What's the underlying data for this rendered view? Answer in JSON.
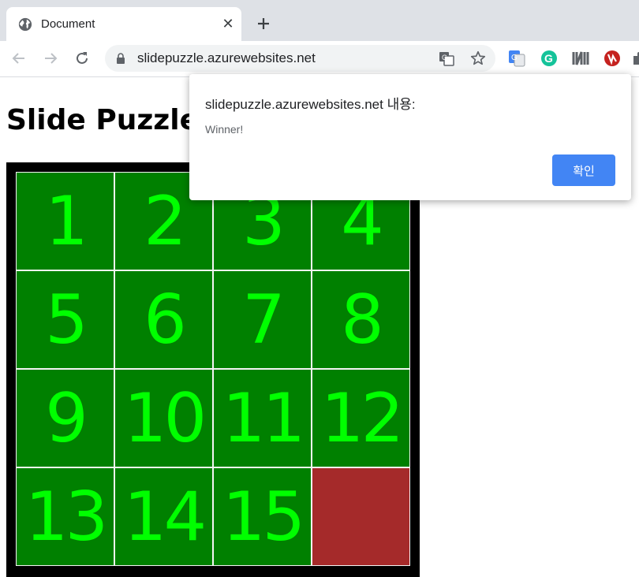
{
  "browser": {
    "tab_title": "Document",
    "url": "slidepuzzle.azurewebsites.net"
  },
  "page": {
    "title": "Slide Puzzle",
    "tiles": [
      "1",
      "2",
      "3",
      "4",
      "5",
      "6",
      "7",
      "8",
      "9",
      "10",
      "11",
      "12",
      "13",
      "14",
      "15",
      ""
    ],
    "tile_color": "#008000",
    "tile_text_color": "#00ff00",
    "empty_tile_color": "#a52a2a"
  },
  "dialog": {
    "title": "slidepuzzle.azurewebsites.net 내용:",
    "message": "Winner!",
    "ok_label": "확인"
  },
  "icons": [
    "globe-icon",
    "close-icon",
    "plus-icon",
    "back-arrow-icon",
    "forward-arrow-icon",
    "reload-icon",
    "lock-icon",
    "translate-icon",
    "star-icon",
    "google-translate-extension-icon",
    "grammarly-icon",
    "notion-extension-icon",
    "red-extension-icon",
    "puzzle-extension-icon"
  ]
}
